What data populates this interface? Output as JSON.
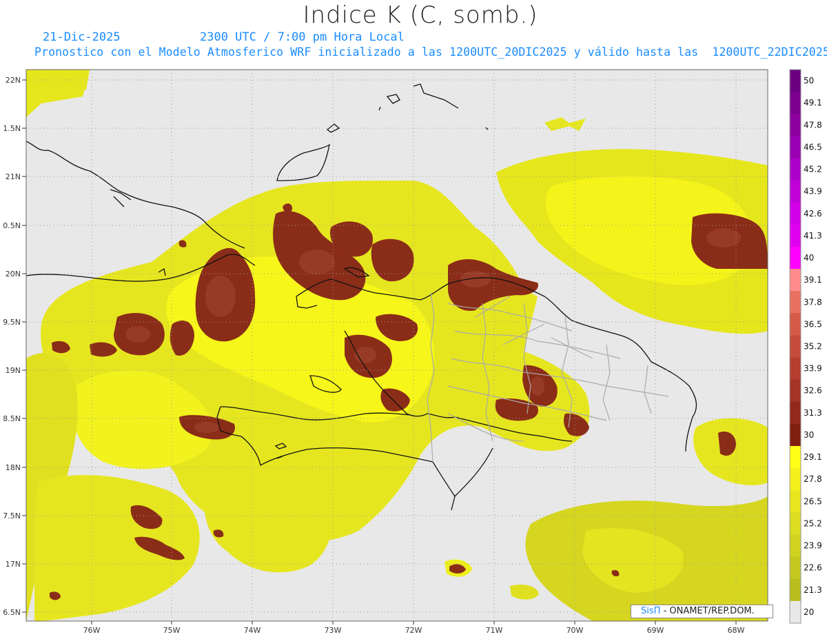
{
  "header": {
    "title": "Indice K (C, somb.)",
    "date": "21-Dic-2025",
    "time": "2300 UTC / 7:00 pm Hora Local",
    "description": "Pronostico con el Modelo Atmosferico WRF inicializado a las 1200UTC_20DIC2025 y válido hasta las  1200UTC_22DIC2025"
  },
  "map": {
    "lat_labels": [
      "22N",
      "1.5N",
      "21N",
      "0.5N",
      "20N",
      "9.5N",
      "19N",
      "8.5N",
      "18N",
      "7.5N",
      "17N",
      "6.5N"
    ],
    "lon_labels": [
      "76W",
      "75W",
      "74W",
      "73W",
      "72W",
      "71W",
      "70W",
      "69W",
      "68W"
    ],
    "background_color": "#e8e8e8",
    "grid": true,
    "variable": "K index shading"
  },
  "colorbar": {
    "levels": [
      "50",
      "49.1",
      "47.8",
      "46.5",
      "45.2",
      "43.9",
      "42.6",
      "41.3",
      "40",
      "39.1",
      "37.8",
      "36.5",
      "35.2",
      "33.9",
      "32.6",
      "31.3",
      "30",
      "29.1",
      "27.8",
      "26.5",
      "25.2",
      "23.9",
      "22.6",
      "21.3",
      "20"
    ],
    "colors": [
      "#6a0080",
      "#7b0090",
      "#8c00a0",
      "#9b00b4",
      "#ad00c8",
      "#bf00d8",
      "#d100e6",
      "#e000f0",
      "#ff00ff",
      "#ff8c8c",
      "#e87060",
      "#d65a4a",
      "#c54c3c",
      "#b53e30",
      "#a33426",
      "#93291c",
      "#7f1f10",
      "#ffff18",
      "#f4f01c",
      "#e8e61e",
      "#dcdc20",
      "#d0d220",
      "#c4c820",
      "#b8be20",
      "#e8e8e8"
    ]
  },
  "credit": {
    "logo": "SisΠ",
    "text": "- ONAMET/REP.DOM."
  }
}
